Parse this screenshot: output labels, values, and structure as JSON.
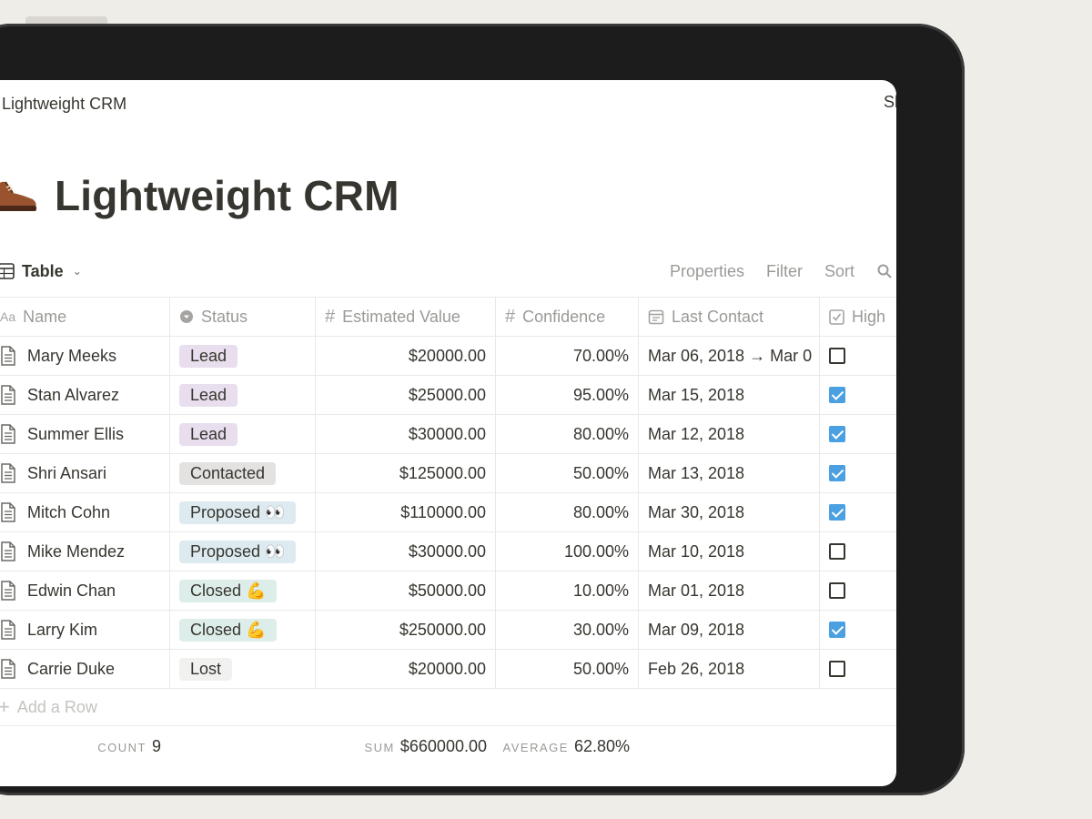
{
  "window": {
    "breadcrumb": "Lightweight CRM",
    "right_clip": "Sh"
  },
  "page": {
    "title": "Lightweight CRM"
  },
  "view": {
    "label": "Table",
    "actions": [
      "Properties",
      "Filter",
      "Sort"
    ]
  },
  "columns": {
    "name": "Name",
    "status": "Status",
    "value": "Estimated Value",
    "confidence": "Confidence",
    "last_contact": "Last Contact",
    "high": "High"
  },
  "rows": [
    {
      "name": "Mary Meeks",
      "status": "Lead",
      "value": "$20000.00",
      "confidence": "70.00%",
      "last_contact": "Mar 06, 2018 → Mar 0",
      "high": false
    },
    {
      "name": "Stan Alvarez",
      "status": "Lead",
      "value": "$25000.00",
      "confidence": "95.00%",
      "last_contact": "Mar 15, 2018",
      "high": true
    },
    {
      "name": "Summer Ellis",
      "status": "Lead",
      "value": "$30000.00",
      "confidence": "80.00%",
      "last_contact": "Mar 12, 2018",
      "high": true
    },
    {
      "name": "Shri Ansari",
      "status": "Contacted",
      "value": "$125000.00",
      "confidence": "50.00%",
      "last_contact": "Mar 13, 2018",
      "high": true
    },
    {
      "name": "Mitch Cohn",
      "status": "Proposed 👀",
      "value": "$110000.00",
      "confidence": "80.00%",
      "last_contact": "Mar 30, 2018",
      "high": true
    },
    {
      "name": "Mike Mendez",
      "status": "Proposed 👀",
      "value": "$30000.00",
      "confidence": "100.00%",
      "last_contact": "Mar 10, 2018",
      "high": false
    },
    {
      "name": "Edwin Chan",
      "status": "Closed 💪",
      "value": "$50000.00",
      "confidence": "10.00%",
      "last_contact": "Mar 01, 2018",
      "high": false
    },
    {
      "name": "Larry Kim",
      "status": "Closed 💪",
      "value": "$250000.00",
      "confidence": "30.00%",
      "last_contact": "Mar 09, 2018",
      "high": true
    },
    {
      "name": "Carrie Duke",
      "status": "Lost",
      "value": "$20000.00",
      "confidence": "50.00%",
      "last_contact": "Feb 26, 2018",
      "high": false
    }
  ],
  "status_colors": {
    "Lead": "#e8deee",
    "Contacted": "#e3e2e0",
    "Proposed": "#ddebf1",
    "Closed": "#ddedea",
    "Lost": "#f1f1ef"
  },
  "add_row_label": "Add a Row",
  "footer": {
    "count_label": "COUNT",
    "count_value": "9",
    "sum_label": "SUM",
    "sum_value": "$660000.00",
    "avg_label": "AVERAGE",
    "avg_value": "62.80%"
  }
}
